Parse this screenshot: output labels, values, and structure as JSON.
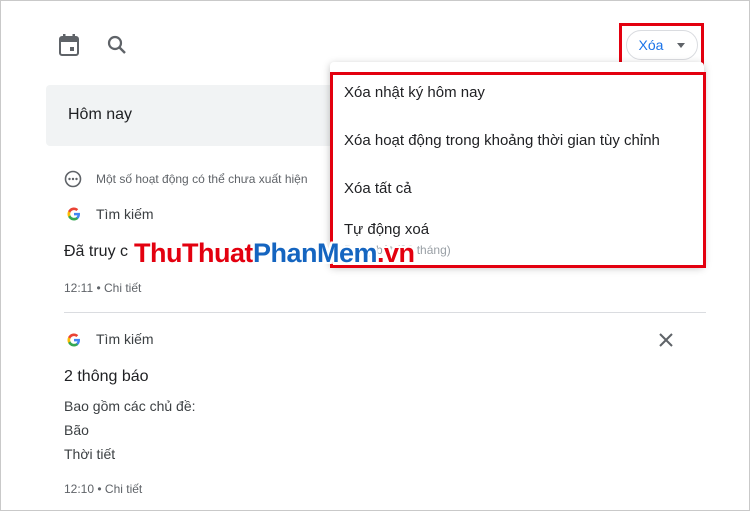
{
  "toolbar": {
    "calendar_icon": "calendar-icon",
    "search_icon": "search-icon",
    "delete_button_label": "Xóa"
  },
  "today_label": "Hôm nay",
  "notice": "Một số hoạt động có thể chưa xuất hiện",
  "items": [
    {
      "source": "Tìm kiếm",
      "title": "Đã truy c",
      "meta": "12:11 • Chi tiết"
    },
    {
      "source": "Tìm kiếm",
      "title": "2 thông báo",
      "lines": [
        "Bao gồm các chủ đề:",
        "Bão",
        "Thời tiết"
      ],
      "meta": "12:10 • Chi tiết"
    }
  ],
  "menu": {
    "items": [
      "Xóa nhật ký hôm nay",
      "Xóa hoạt động trong khoảng thời gian tùy chỉnh",
      "Xóa tất cả",
      "Tự động xoá"
    ],
    "auto_delete_sub": "Đang bật (36 tháng)"
  },
  "watermark": {
    "part1": "ThuThuat",
    "part2": "PhanMem",
    "part3": ".vn"
  },
  "colors": {
    "accent": "#1a73e8",
    "highlight": "#e3000f"
  }
}
